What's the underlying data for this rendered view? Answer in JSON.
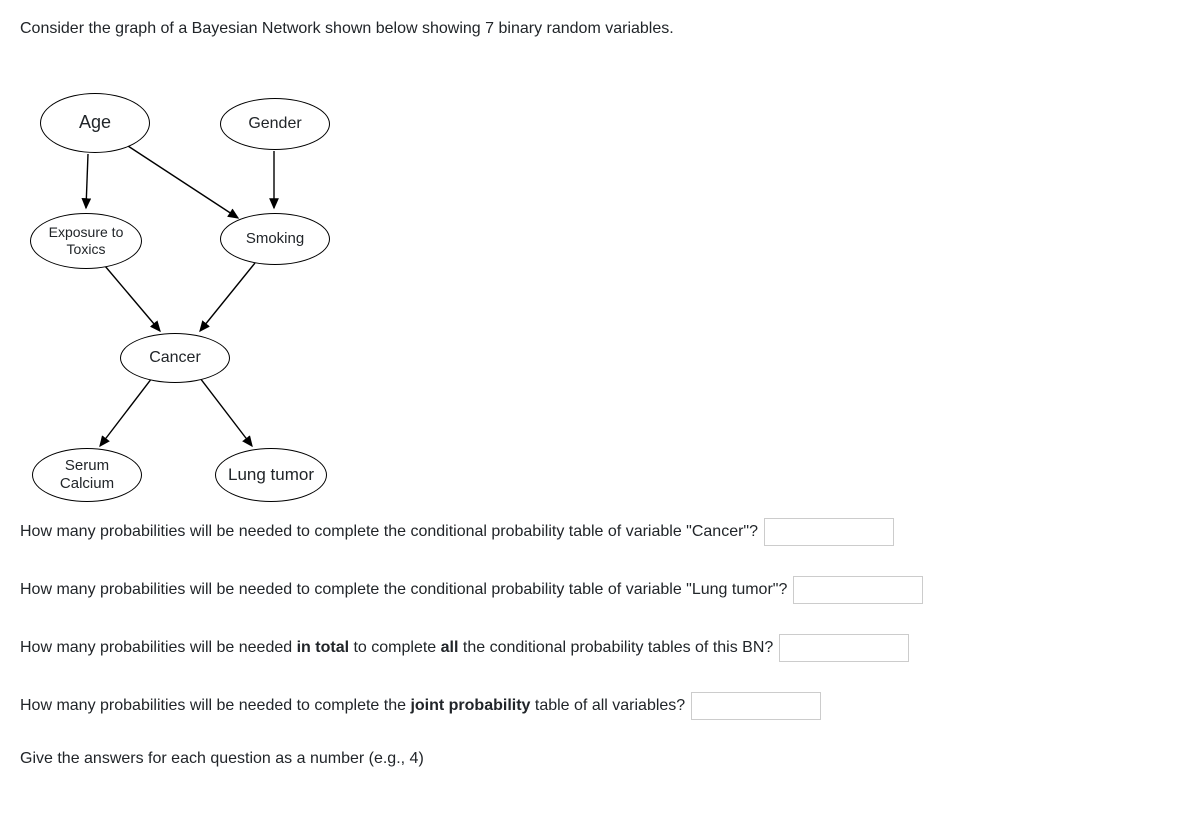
{
  "prompt": "Consider the graph of a Bayesian Network shown below showing 7 binary random variables.",
  "nodes": {
    "age": "Age",
    "gender": "Gender",
    "exposure": "Exposure to Toxics",
    "smoking": "Smoking",
    "cancer": "Cancer",
    "serum": "Serum Calcium",
    "lung": "Lung tumor"
  },
  "questions": {
    "q1": "How many probabilities will be needed to complete the conditional probability table of variable \"Cancer\"?",
    "q2": "How many probabilities will be needed to complete the conditional probability table of variable \"Lung tumor\"?",
    "q3_pre": "How many probabilities will be needed ",
    "q3_bold": "in total",
    "q3_mid": " to complete ",
    "q3_bold2": "all",
    "q3_post": " the conditional probability tables of this BN?",
    "q4_pre": "How many probabilities will be needed to complete the ",
    "q4_bold": "joint probability",
    "q4_post": " table of all variables?"
  },
  "note": "Give the answers for each question as a number (e.g., 4)",
  "inputs": {
    "a1": "",
    "a2": "",
    "a3": "",
    "a4": ""
  }
}
